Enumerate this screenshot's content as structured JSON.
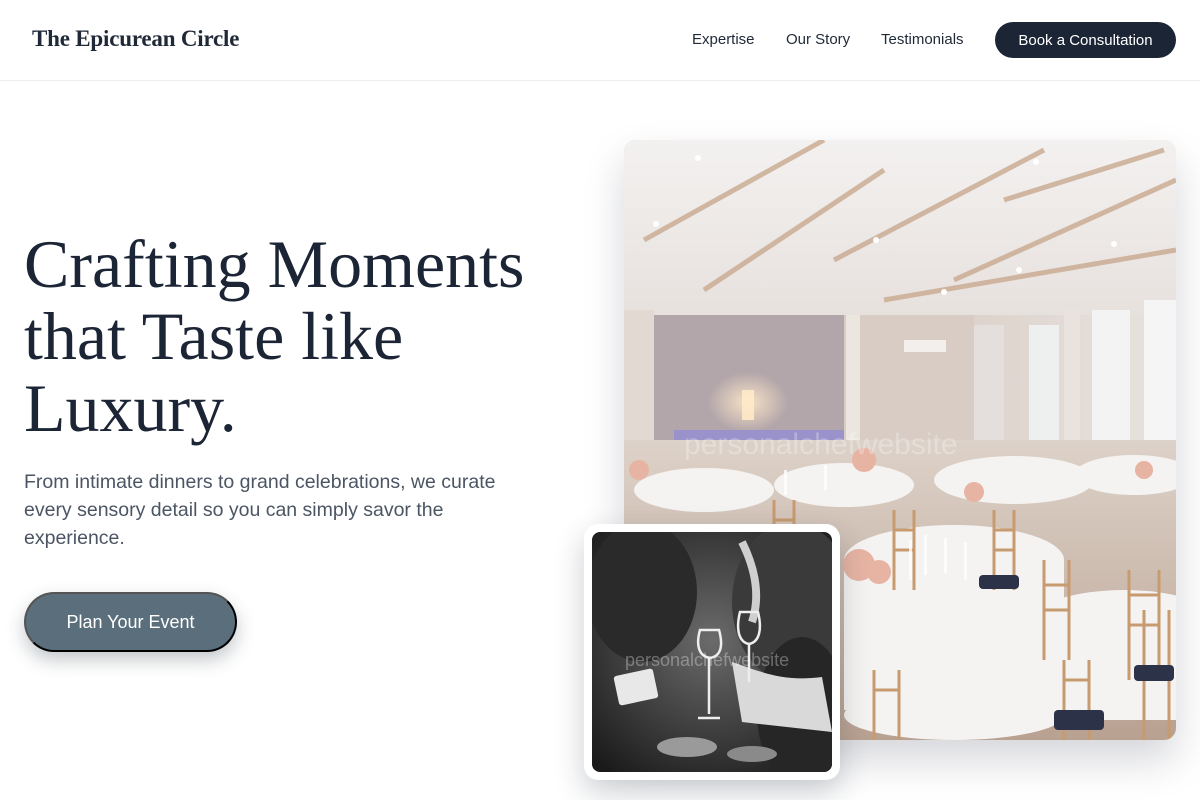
{
  "header": {
    "logo": "The Epicurean Circle",
    "nav": [
      "Expertise",
      "Our Story",
      "Testimonials"
    ],
    "cta": "Book a Consultation"
  },
  "hero": {
    "title": "Crafting Moments that Taste like Luxury.",
    "subtitle": "From intimate dinners to grand celebrations, we curate every sensory detail so you can simply savor the experience.",
    "cta": "Plan Your Event"
  },
  "images": {
    "main_watermark": "personalchefwebsite",
    "inset_watermark": "personalchefwebsite"
  },
  "colors": {
    "primary_dark": "#1c2535",
    "hero_button": "#5a6e7b",
    "text_muted": "#4b5563"
  }
}
